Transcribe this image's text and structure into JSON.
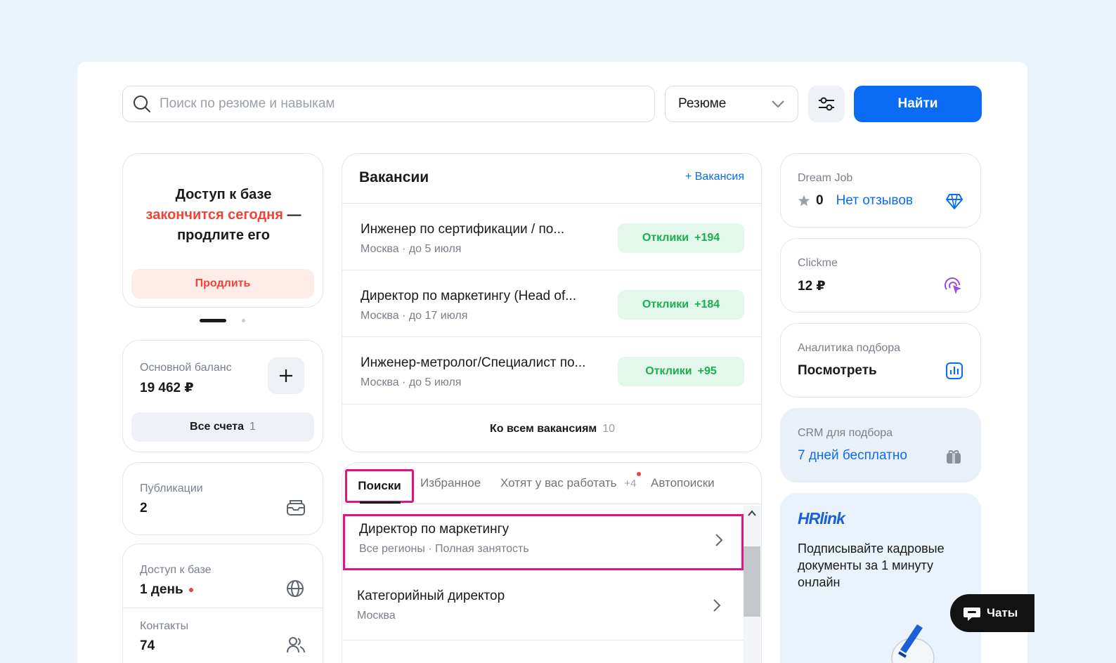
{
  "search": {
    "placeholder": "Поиск по резюме и навыкам",
    "type_selected": "Резюме",
    "find_label": "Найти"
  },
  "promo": {
    "line1": "Доступ к базе",
    "line2_red": "закончится сегодня",
    "line2_rest": " —",
    "line3": "продлите его",
    "button": "Продлить"
  },
  "balance": {
    "label": "Основной баланс",
    "value": "19 462 ₽",
    "all_accounts": "Все счета",
    "accounts_count": "1"
  },
  "publications": {
    "label": "Публикации",
    "value": "2"
  },
  "db_access": {
    "label": "Доступ к базе",
    "value": "1 день"
  },
  "contacts": {
    "label": "Контакты",
    "value": "74"
  },
  "vacancies": {
    "title": "Вакансии",
    "add_label": "+ Вакансия",
    "items": [
      {
        "title": "Инженер по сертификации / по...",
        "sub": "Москва · до 5 июля",
        "resp_label": "Отклики",
        "resp_count": "+194"
      },
      {
        "title": "Директор по маркетингу (Head of...",
        "sub": "Москва · до 17 июля",
        "resp_label": "Отклики",
        "resp_count": "+184"
      },
      {
        "title": "Инженер-метролог/Специалист по...",
        "sub": "Москва · до 5 июля",
        "resp_label": "Отклики",
        "resp_count": "+95"
      }
    ],
    "all_label": "Ко всем вакансиям",
    "all_count": "10"
  },
  "tabs": [
    {
      "label": "Поиски"
    },
    {
      "label": "Избранное"
    },
    {
      "label": "Хотят у вас работать",
      "badge": "+4"
    },
    {
      "label": "Автопоиски"
    }
  ],
  "searches": [
    {
      "title": "Директор по маркетингу",
      "sub": "Все регионы · Полная занятость"
    },
    {
      "title": "Категорийный директор",
      "sub": "Москва"
    }
  ],
  "dreamjob": {
    "label": "Dream Job",
    "rating": "0",
    "reviews": "Нет отзывов"
  },
  "clickme": {
    "label": "Clickme",
    "value": "12 ₽"
  },
  "analytics": {
    "label": "Аналитика подбора",
    "value": "Посмотреть"
  },
  "crm": {
    "label": "CRM для подбора",
    "value": "7 дней бесплатно"
  },
  "hrlink": {
    "logo": "HRlink",
    "text": "Подписывайте кадровые документы за 1 минуту онлайн"
  },
  "chat": {
    "label": "Чаты"
  },
  "colors": {
    "accent": "#0a6cf5",
    "danger": "#f04438",
    "success": "#19b04f",
    "highlight": "#e0157f"
  }
}
